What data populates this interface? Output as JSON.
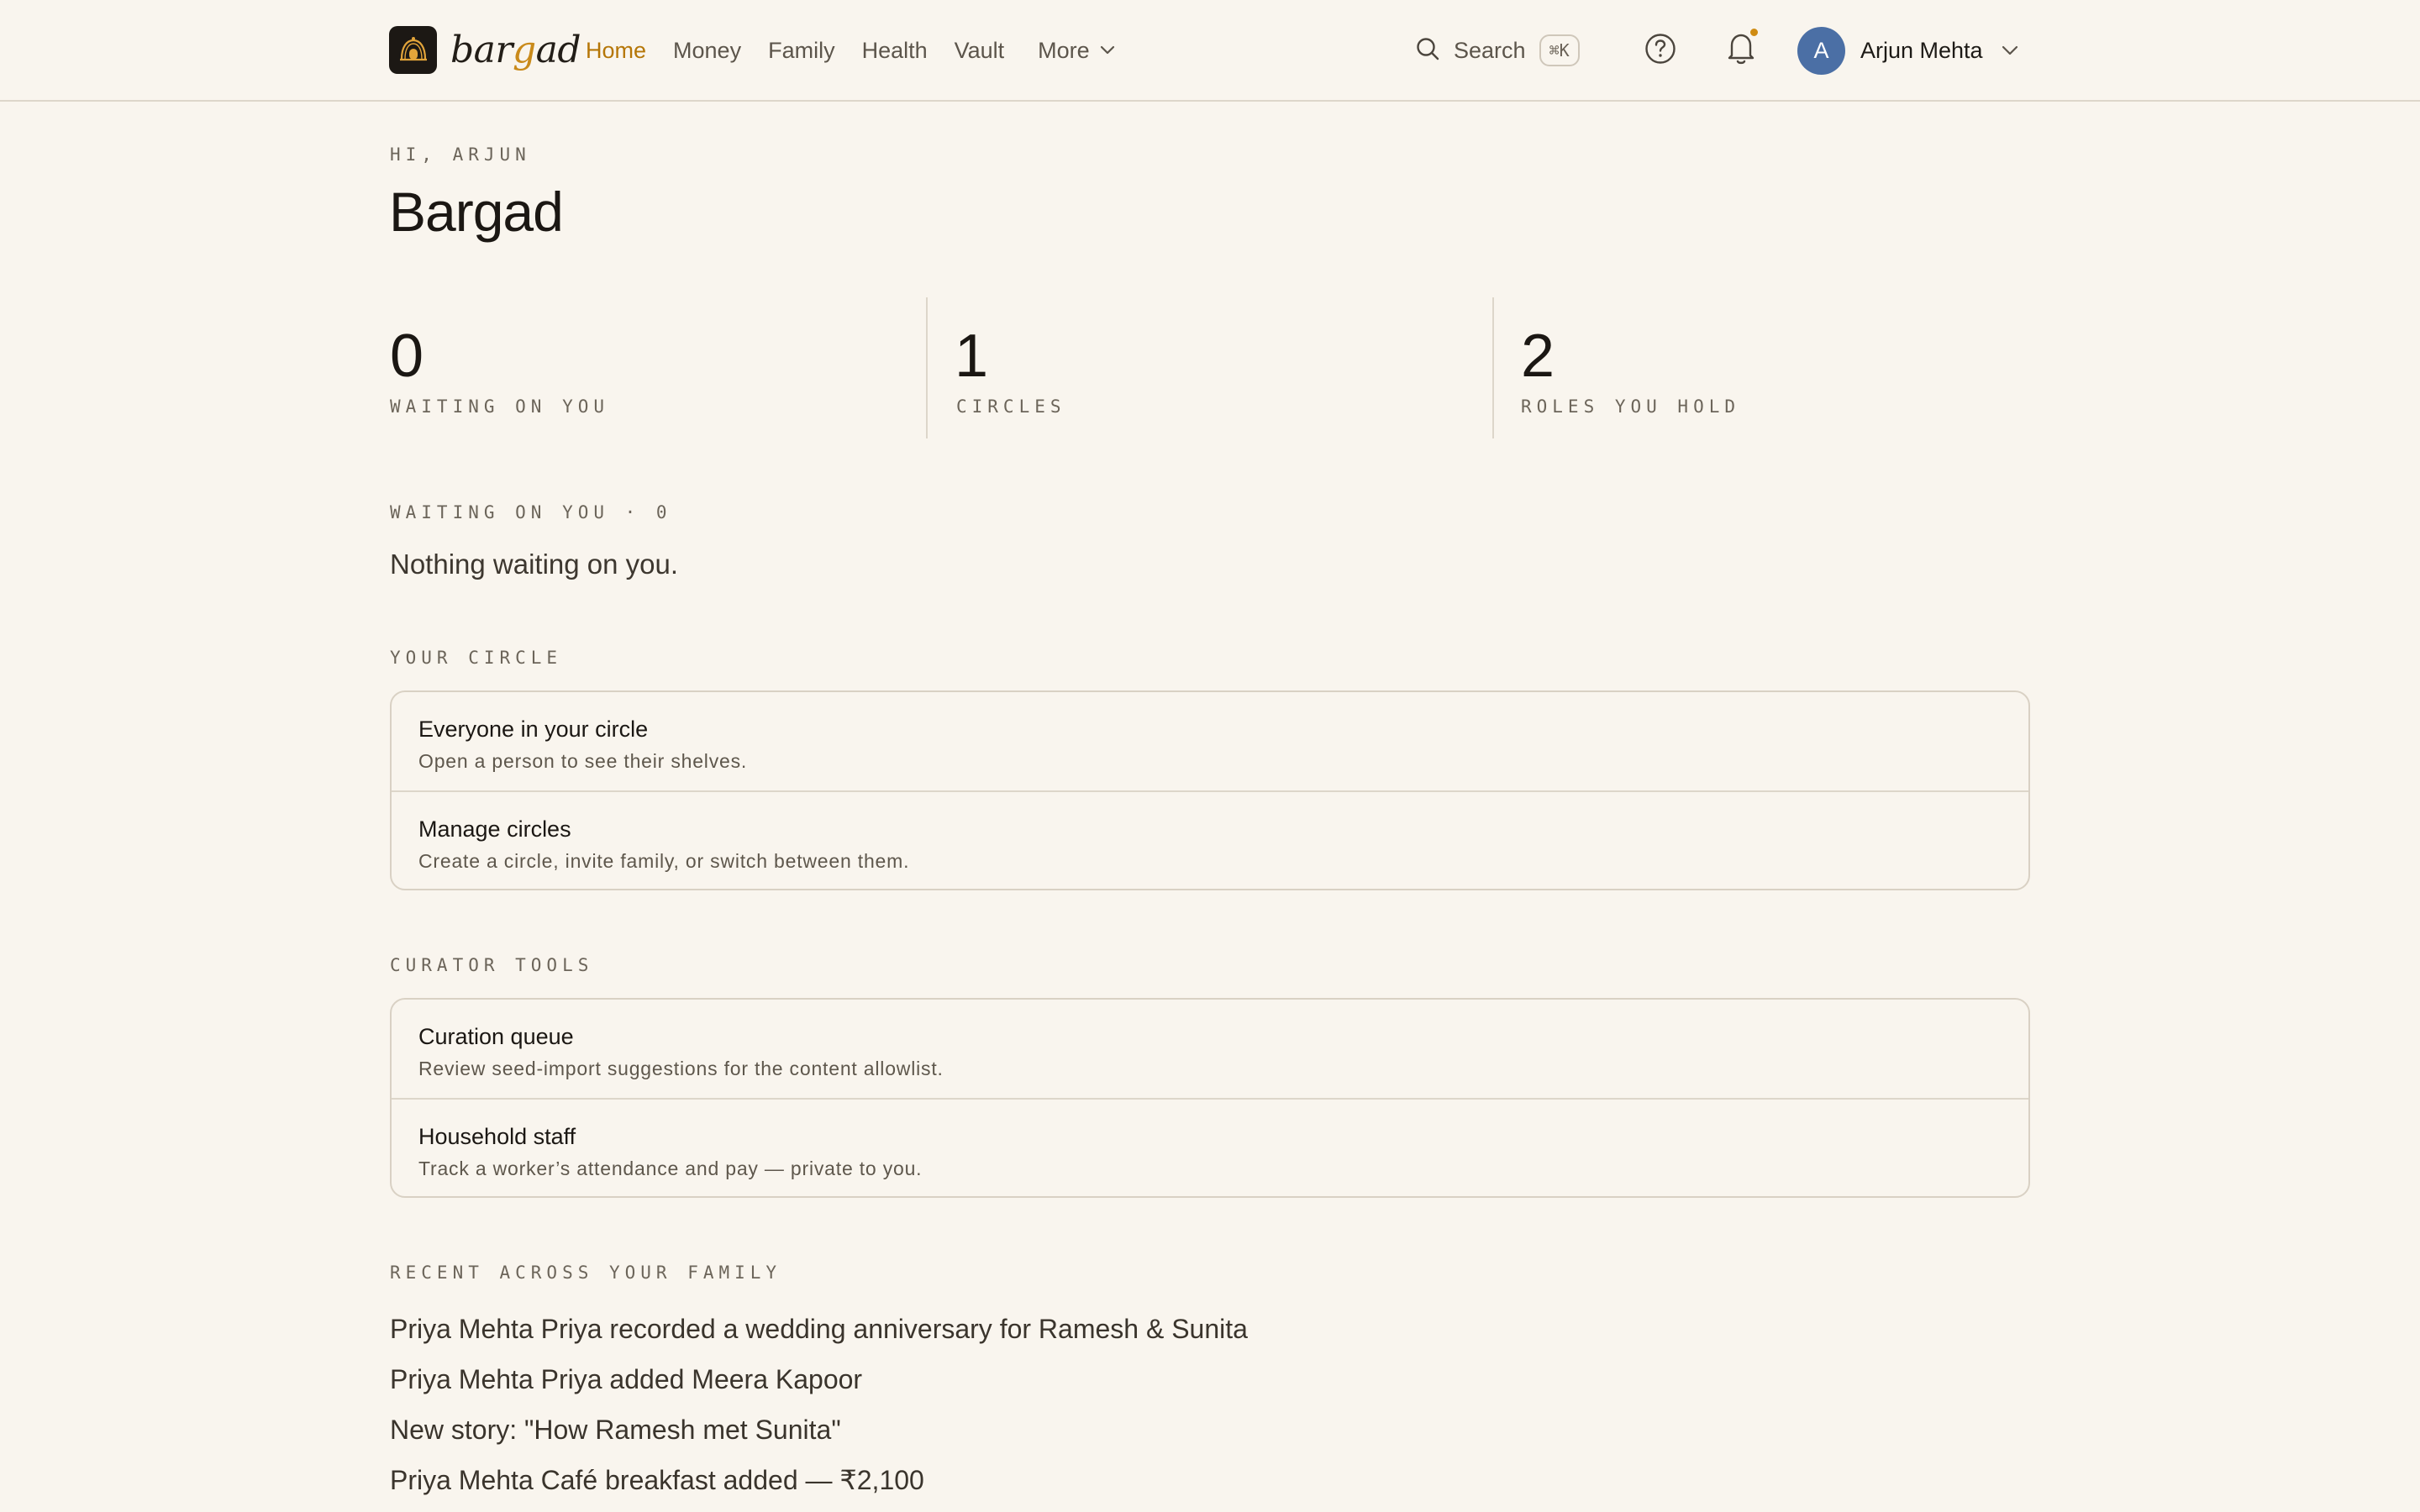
{
  "app": {
    "logo_word_a": "bar",
    "logo_word_g": "g",
    "logo_word_b": "ad"
  },
  "nav": {
    "items": [
      {
        "label": "Home",
        "active": true
      },
      {
        "label": "Money"
      },
      {
        "label": "Family"
      },
      {
        "label": "Health"
      },
      {
        "label": "Vault"
      }
    ],
    "more_label": "More"
  },
  "search": {
    "label": "Search",
    "shortcut": "⌘K"
  },
  "user": {
    "initial": "A",
    "name": "Arjun Mehta"
  },
  "colors": {
    "accent": "#b57607",
    "notification_dot": "#cf8b12",
    "avatar": "#4b6fa5",
    "background": "#f9f5ee"
  },
  "main": {
    "greeting": "HI, ARJUN",
    "title": "Bargad",
    "stats": [
      {
        "value": "0",
        "label": "WAITING ON YOU"
      },
      {
        "value": "1",
        "label": "CIRCLES"
      },
      {
        "value": "2",
        "label": "ROLES YOU HOLD"
      }
    ],
    "waiting": {
      "title": "WAITING ON YOU · 0",
      "empty_text": "Nothing waiting on you."
    },
    "circle": {
      "title": "YOUR CIRCLE",
      "rows": [
        {
          "title": "Everyone in your circle",
          "subtitle": "Open a person to see their shelves."
        },
        {
          "title": "Manage circles",
          "subtitle": "Create a circle, invite family, or switch between them."
        }
      ]
    },
    "curator": {
      "title": "CURATOR TOOLS",
      "rows": [
        {
          "title": "Curation queue",
          "subtitle": "Review seed-import suggestions for the content allowlist."
        },
        {
          "title": "Household staff",
          "subtitle": "Track a worker’s attendance and pay — private to you."
        }
      ]
    },
    "recent": {
      "title": "RECENT ACROSS YOUR FAMILY",
      "items": [
        "Priya Mehta Priya recorded a wedding anniversary for Ramesh & Sunita",
        "Priya Mehta Priya added Meera Kapoor",
        "New story: \"How Ramesh met Sunita\"",
        "Priya Mehta Café breakfast added — ₹2,100"
      ]
    }
  }
}
